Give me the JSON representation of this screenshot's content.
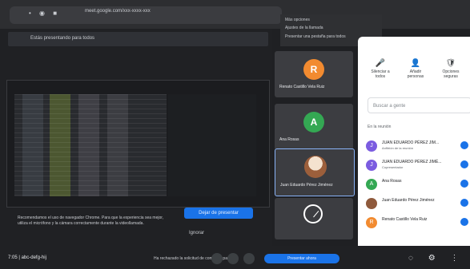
{
  "browser": {
    "url": "meet.google.com/xxx-xxxx-xxx"
  },
  "presenting": {
    "label": "Estás presentando para todos"
  },
  "notice": {
    "text": "Recomendamos el uso de navegador Chrome. Para que la experiencia sea mejor, utiliza el micrófono y la cámara correctamente durante la videollamada."
  },
  "buttons": {
    "stop_presenting": "Dejar de presentar",
    "secondary": "Ignorar"
  },
  "tiles": [
    {
      "initial": "R",
      "name": "Renato Castillo Vela Ruiz",
      "color": "#f28b30"
    },
    {
      "initial": "A",
      "name": "Ana Rosas",
      "color": "#34a853"
    },
    {
      "initial": "",
      "name": "Juan Eduardo Pérez Jiménez",
      "color": "#9c5f3b"
    },
    {
      "initial": "",
      "name": "",
      "color": "#3c4043"
    }
  ],
  "popup": {
    "line1": "Más opciones",
    "line2": "Ajustes de la llamada",
    "line3": "Presentar una pestaña para todos"
  },
  "panel": {
    "actions": [
      {
        "label": "Silenciar a todos",
        "icon": "mic-off-icon"
      },
      {
        "label": "Añadir personas",
        "icon": "person-add-icon"
      },
      {
        "label": "Opciones seguras",
        "icon": "shield-icon"
      }
    ],
    "search_placeholder": "Buscar a gente",
    "section": "En la reunión",
    "people": [
      {
        "name": "JUAN EDUARDO PÉREZ JIM...",
        "sub": "Anfitrión de la reunión",
        "color": "#7b5ce0"
      },
      {
        "name": "JUAN EDUARDO PÉREZ JIMÉ...",
        "sub": "Copresentador",
        "color": "#7b5ce0"
      },
      {
        "name": "Ana Rosas",
        "sub": "",
        "color": "#34a853"
      },
      {
        "name": "Juan Eduardo Pérez Jiménez",
        "sub": "",
        "color": "#8f5a3c"
      },
      {
        "name": "Renato Castillo Vela Ruiz",
        "sub": "",
        "color": "#f28b30"
      }
    ]
  },
  "bottom": {
    "time": "7:05 | abc-defg-hij",
    "message": "Ha rechazado la solicitud de compartir pantalla",
    "present_now": "Presentar ahora"
  }
}
